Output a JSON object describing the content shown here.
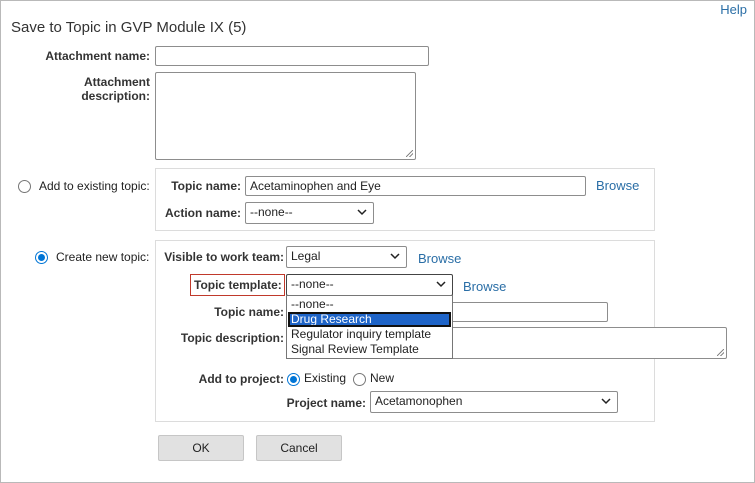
{
  "header": {
    "title": "Save to Topic in GVP Module IX (5)",
    "help": "Help"
  },
  "attachment": {
    "name_label": "Attachment name:",
    "name_value": "",
    "description_label_line1": "Attachment",
    "description_label_line2": "description:"
  },
  "existing_topic": {
    "radio_label": "Add to existing topic:",
    "selected": false,
    "topic_name_label": "Topic name:",
    "topic_name_value": "Acetaminophen and Eye",
    "browse": "Browse",
    "action_name_label": "Action name:",
    "action_name_value": "--none--"
  },
  "new_topic": {
    "radio_label": "Create new topic:",
    "selected": true,
    "visible_label": "Visible to work team:",
    "visible_value": "Legal",
    "visible_browse": "Browse",
    "template_label": "Topic template:",
    "template_value": "--none--",
    "template_browse": "Browse",
    "template_options": [
      "--none--",
      "Drug Research",
      "Regulator inquiry template",
      "Signal Review Template"
    ],
    "template_highlighted_option": "Drug Research",
    "topic_name_label": "Topic name:",
    "topic_description_label": "Topic description:",
    "add_to_project_label": "Add to project:",
    "project_existing": "Existing",
    "project_new": "New",
    "project_choice": "Existing",
    "project_name_label": "Project name:",
    "project_name_value": "Acetamonophen"
  },
  "buttons": {
    "ok": "OK",
    "cancel": "Cancel"
  },
  "colors": {
    "link": "#2a6ea6",
    "radio_accent": "#0075d6",
    "highlight": "#1e64c8",
    "error_outline": "#c0392b"
  }
}
